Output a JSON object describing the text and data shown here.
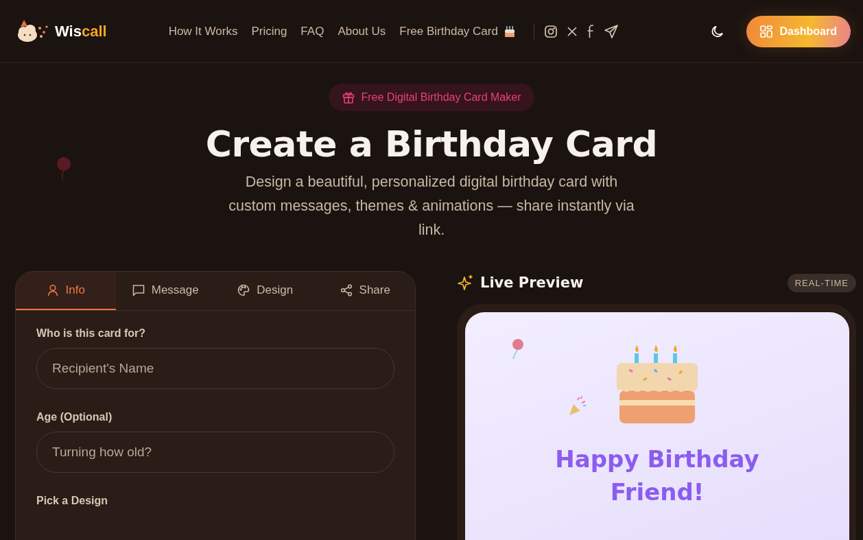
{
  "header": {
    "logo": {
      "part_1": "Wis",
      "part_2": "call"
    },
    "nav": [
      {
        "label": "How It Works",
        "kind": "text"
      },
      {
        "label": "Pricing",
        "kind": "text"
      },
      {
        "label": "FAQ",
        "kind": "text"
      },
      {
        "label": "About Us",
        "kind": "text"
      },
      {
        "label": "Free Birthday Card",
        "kind": "cake"
      }
    ],
    "social": [
      {
        "kind": "instagram"
      },
      {
        "kind": "x"
      },
      {
        "kind": "facebook"
      },
      {
        "kind": "telegram"
      }
    ],
    "dashboard_button": "Dashboard"
  },
  "hero": {
    "badge": "Free Digital Birthday Card Maker",
    "title": "Create a Birthday Card",
    "subtitle": "Design a beautiful, personalized digital birthday card with custom messages, themes & animations — share instantly via link."
  },
  "editor": {
    "tabs": [
      {
        "label": "Info",
        "kind": "user",
        "selected": true
      },
      {
        "label": "Message",
        "kind": "message",
        "selected": false
      },
      {
        "label": "Design",
        "kind": "palette",
        "selected": false
      },
      {
        "label": "Share",
        "kind": "share",
        "selected": false
      }
    ],
    "fields": [
      {
        "label": "Who is this card for?",
        "placeholder": "Recipient's Name"
      },
      {
        "label": "Age (Optional)",
        "placeholder": "Turning how old?"
      }
    ],
    "design_label": "Pick a Design"
  },
  "preview": {
    "title": "Live Preview",
    "badge": "REAL-TIME",
    "greeting": "Happy Birthday Friend!"
  }
}
